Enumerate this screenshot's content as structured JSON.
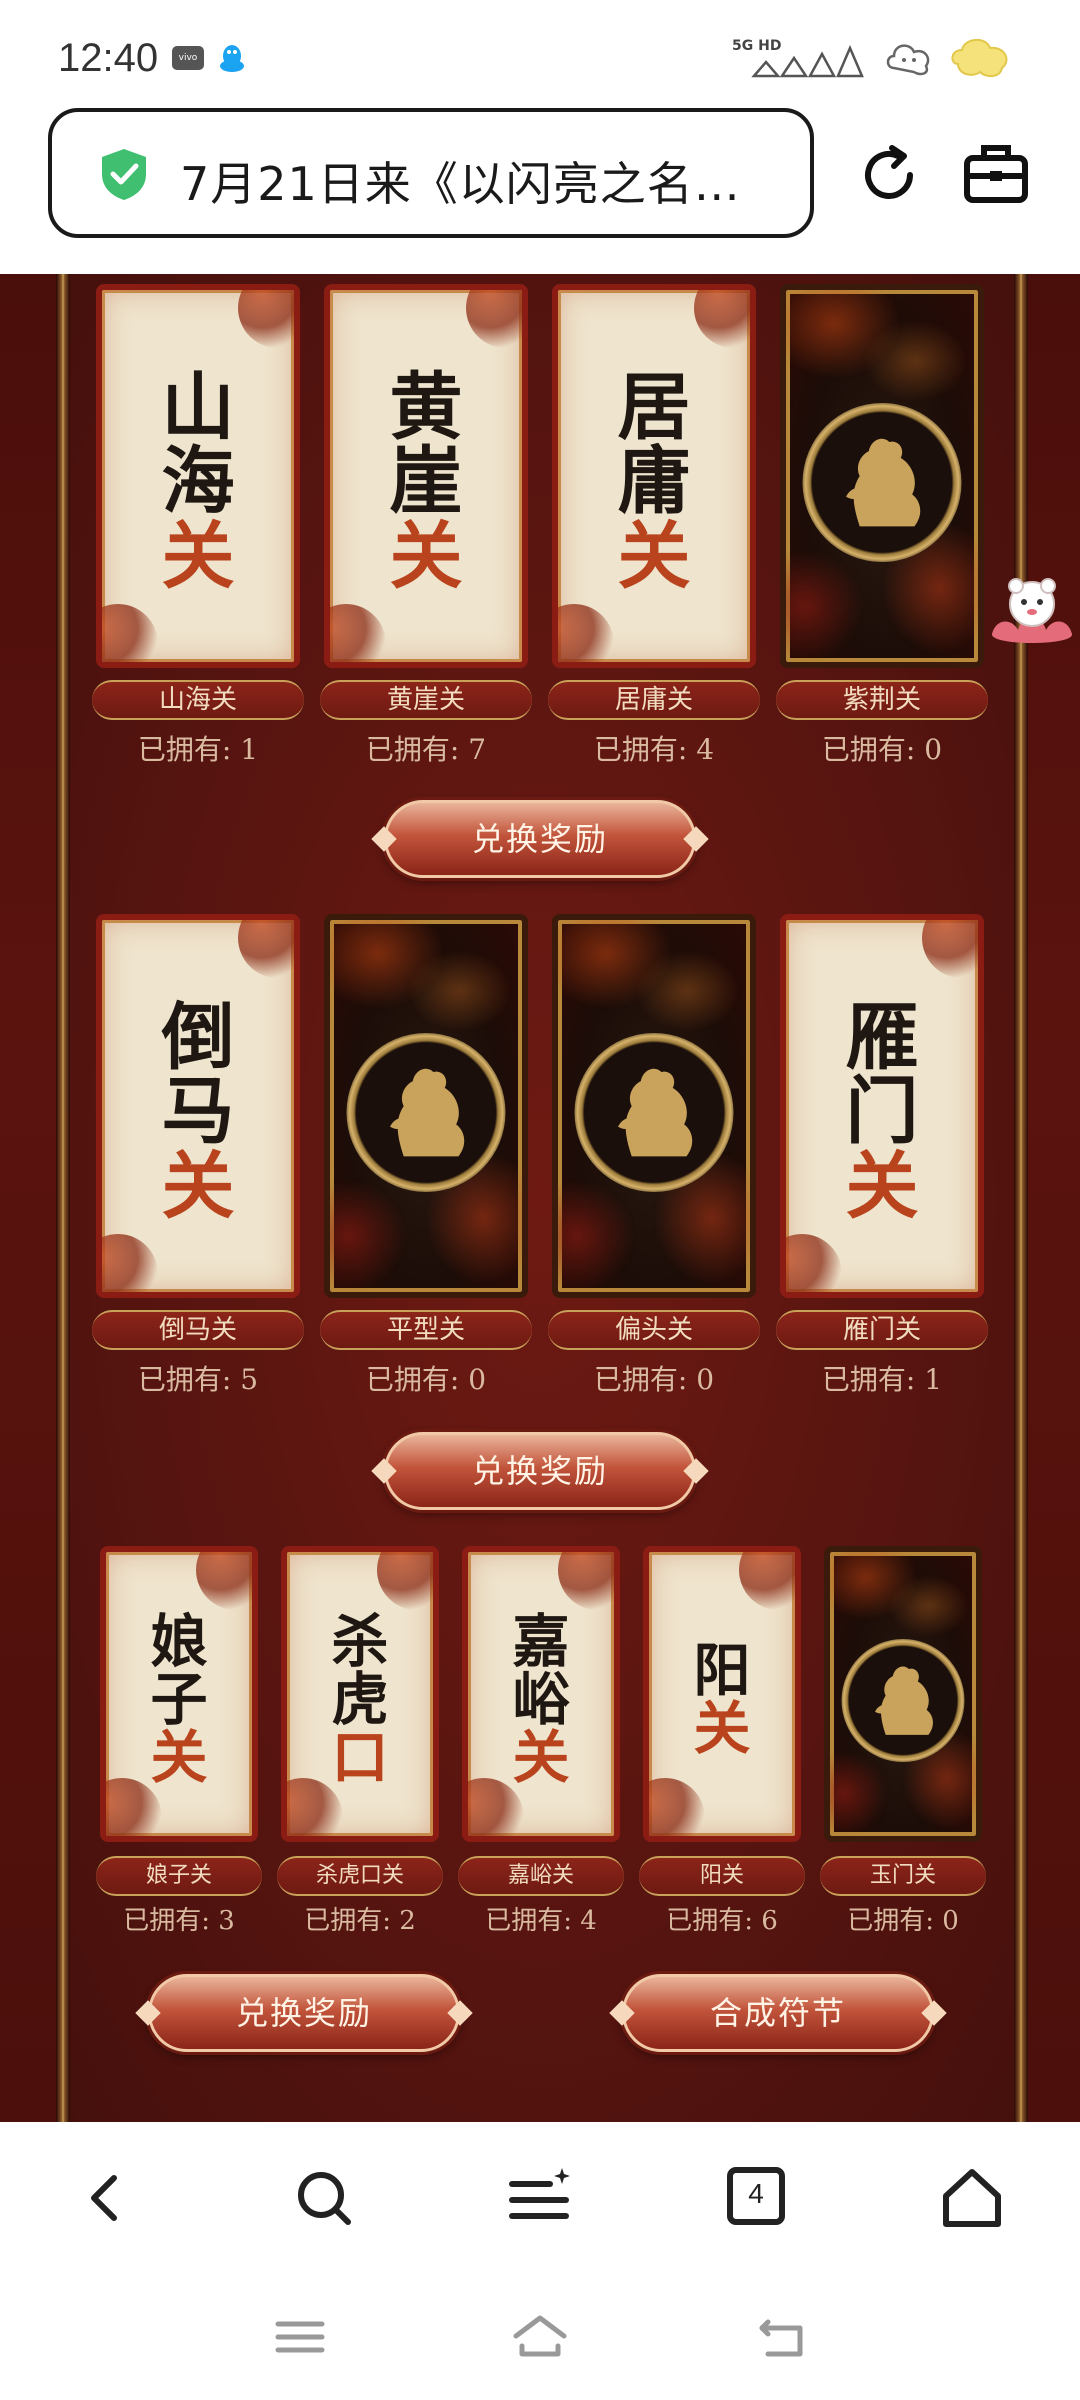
{
  "status_bar": {
    "time": "12:40",
    "vivo_badge": "vivo",
    "qq_icon": "qq-penguin-icon",
    "network": "5G HD",
    "signal_icon": "signal-bars-icon",
    "cloud_icon": "cloud-mascot-icon",
    "battery_icon": "battery-icon"
  },
  "browser": {
    "url_title": "7月21日来《以闪亮之名…",
    "secure_icon": "shield-check-icon",
    "reload_icon": "reload-icon",
    "toolbox_icon": "toolbox-icon"
  },
  "sections": [
    {
      "cards": [
        {
          "name": "山海关",
          "owned": "已拥有: 1",
          "style": "light",
          "title_chars": [
            "山",
            "海",
            "关"
          ]
        },
        {
          "name": "黄崖关",
          "owned": "已拥有: 7",
          "style": "light",
          "title_chars": [
            "黄",
            "崖",
            "关"
          ]
        },
        {
          "name": "居庸关",
          "owned": "已拥有: 4",
          "style": "light",
          "title_chars": [
            "居",
            "庸",
            "关"
          ]
        },
        {
          "name": "紫荆关",
          "owned": "已拥有: 0",
          "style": "dark",
          "title_chars": []
        }
      ],
      "buttons": [
        "兑换奖励"
      ]
    },
    {
      "cards": [
        {
          "name": "倒马关",
          "owned": "已拥有: 5",
          "style": "light",
          "title_chars": [
            "倒",
            "马",
            "关"
          ]
        },
        {
          "name": "平型关",
          "owned": "已拥有: 0",
          "style": "dark",
          "title_chars": []
        },
        {
          "name": "偏头关",
          "owned": "已拥有: 0",
          "style": "dark",
          "title_chars": []
        },
        {
          "name": "雁门关",
          "owned": "已拥有: 1",
          "style": "light",
          "title_chars": [
            "雁",
            "门",
            "关"
          ]
        }
      ],
      "buttons": [
        "兑换奖励"
      ]
    },
    {
      "cards": [
        {
          "name": "娘子关",
          "owned": "已拥有: 3",
          "style": "light",
          "title_chars": [
            "娘",
            "子",
            "关"
          ]
        },
        {
          "name": "杀虎口关",
          "owned": "已拥有: 2",
          "style": "light",
          "title_chars": [
            "杀",
            "虎",
            "口"
          ]
        },
        {
          "name": "嘉峪关",
          "owned": "已拥有: 4",
          "style": "light",
          "title_chars": [
            "嘉",
            "峪",
            "关"
          ]
        },
        {
          "name": "阳关",
          "owned": "已拥有: 6",
          "style": "light",
          "title_chars": [
            "阳",
            "关"
          ]
        },
        {
          "name": "玉门关",
          "owned": "已拥有: 0",
          "style": "dark",
          "title_chars": []
        }
      ],
      "buttons": [
        "兑换奖励",
        "合成符节"
      ]
    }
  ],
  "nav": {
    "back_icon": "back-arrow-icon",
    "search_icon": "search-icon",
    "menu_icon": "menu-sparkle-icon",
    "tab_count": "4",
    "home_icon": "home-icon"
  },
  "system_bar": {
    "menu_icon": "hamburger-icon",
    "home_icon": "home-outline-icon",
    "back_icon": "return-icon"
  }
}
